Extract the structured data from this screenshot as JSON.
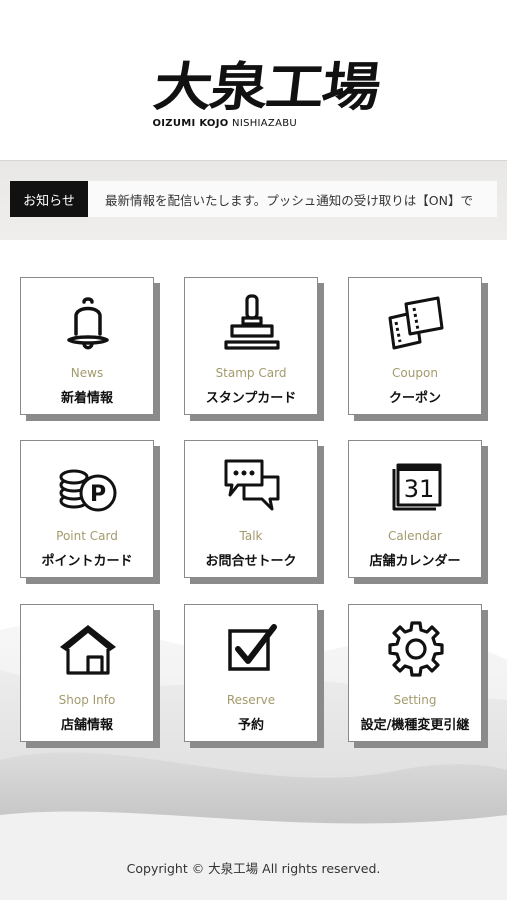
{
  "header": {
    "logo_kanji": "大泉工場",
    "logo_roman_bold": "OIZUMI KOJO",
    "logo_roman_rest": "NISHIAZABU"
  },
  "news": {
    "tag": "お知らせ",
    "text": "最新情報を配信いたします。プッシュ通知の受け取りは【ON】で"
  },
  "menu": [
    {
      "en": "News",
      "jp": "新着情報",
      "icon": "bell-icon"
    },
    {
      "en": "Stamp Card",
      "jp": "スタンプカード",
      "icon": "stamp-icon"
    },
    {
      "en": "Coupon",
      "jp": "クーポン",
      "icon": "ticket-icon"
    },
    {
      "en": "Point Card",
      "jp": "ポイントカード",
      "icon": "coins-icon"
    },
    {
      "en": "Talk",
      "jp": "お問合せトーク",
      "icon": "chat-bubbles-icon"
    },
    {
      "en": "Calendar",
      "jp": "店舗カレンダー",
      "icon": "calendar-icon",
      "calendar_day": "31"
    },
    {
      "en": "Shop Info",
      "jp": "店舗情報",
      "icon": "house-icon"
    },
    {
      "en": "Reserve",
      "jp": "予約",
      "icon": "checkbox-icon"
    },
    {
      "en": "Setting",
      "jp": "設定/機種変更引継",
      "icon": "gear-icon"
    }
  ],
  "coin_letter": "P",
  "footer": {
    "copyright": "Copyright © 大泉工場 All rights reserved."
  },
  "colors": {
    "label_en": "#a39a6c",
    "news_tag_bg": "#111111",
    "tile_shadow": "#8b8b8b"
  }
}
